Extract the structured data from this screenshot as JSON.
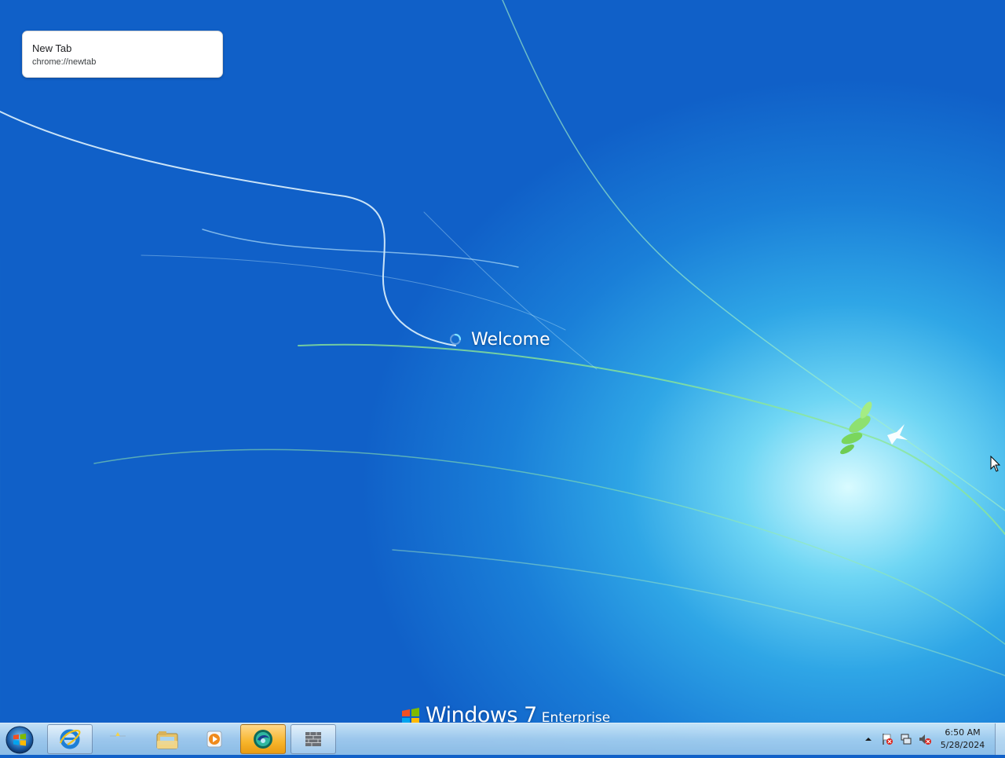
{
  "tooltip": {
    "title": "New Tab",
    "url": "chrome://newtab"
  },
  "welcome": {
    "text": "Welcome"
  },
  "branding": {
    "name": "Windows 7",
    "edition": "Enterprise"
  },
  "taskbar": {
    "items": [
      {
        "name": "internet-explorer",
        "icon": "ie-icon"
      },
      {
        "name": "recycle-bin",
        "icon": "recycle-bin-icon"
      },
      {
        "name": "windows-explorer",
        "icon": "folder-icon"
      },
      {
        "name": "media-player",
        "icon": "media-player-icon"
      },
      {
        "name": "browser",
        "icon": "browser-icon",
        "active": true
      },
      {
        "name": "app",
        "icon": "wall-icon"
      }
    ]
  },
  "tray": {
    "icons": [
      "show-hidden-arrow-icon",
      "action-center-flag-icon",
      "network-icon",
      "volume-muted-icon"
    ],
    "time": "6:50 AM",
    "date": "5/28/2024"
  },
  "colors": {
    "taskbar_active": "#f7b52c",
    "welcome_text": "#ffffff"
  }
}
